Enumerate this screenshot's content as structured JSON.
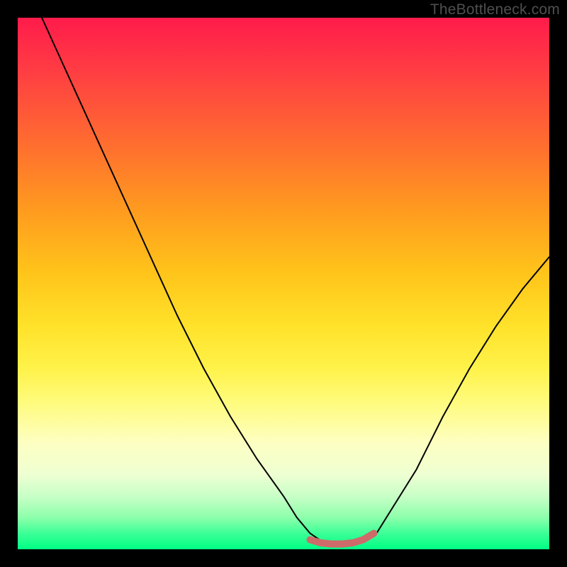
{
  "watermark": "TheBottleneck.com",
  "colors": {
    "frame": "#000000",
    "curve_stroke": "#000000",
    "marker_stroke": "#cf6a6a",
    "gradient_top": "#ff1b4b",
    "gradient_bottom": "#00ff85"
  },
  "chart_data": {
    "type": "line",
    "title": "",
    "xlabel": "",
    "ylabel": "",
    "xlim": [
      0,
      100
    ],
    "ylim": [
      0,
      100
    ],
    "grid": false,
    "series": [
      {
        "name": "bottleneck-curve",
        "x": [
          0,
          5,
          10,
          15,
          20,
          25,
          30,
          35,
          40,
          45,
          50,
          52.5,
          55,
          57.5,
          60,
          62.5,
          65,
          67.5,
          70,
          75,
          80,
          85,
          90,
          95,
          100
        ],
        "y": [
          110,
          99,
          88,
          77,
          66,
          55,
          44,
          34,
          25,
          17,
          10,
          6,
          3,
          1.3,
          0.7,
          0.7,
          1.3,
          3,
          7,
          15,
          25,
          34,
          42,
          49,
          55
        ]
      }
    ],
    "annotations": [
      {
        "name": "optimal-range-marker",
        "type": "segment",
        "x": [
          55,
          57,
          59,
          61,
          63,
          65,
          67
        ],
        "y": [
          1.8,
          1.2,
          1.0,
          1.0,
          1.2,
          1.8,
          3.0
        ]
      }
    ]
  }
}
